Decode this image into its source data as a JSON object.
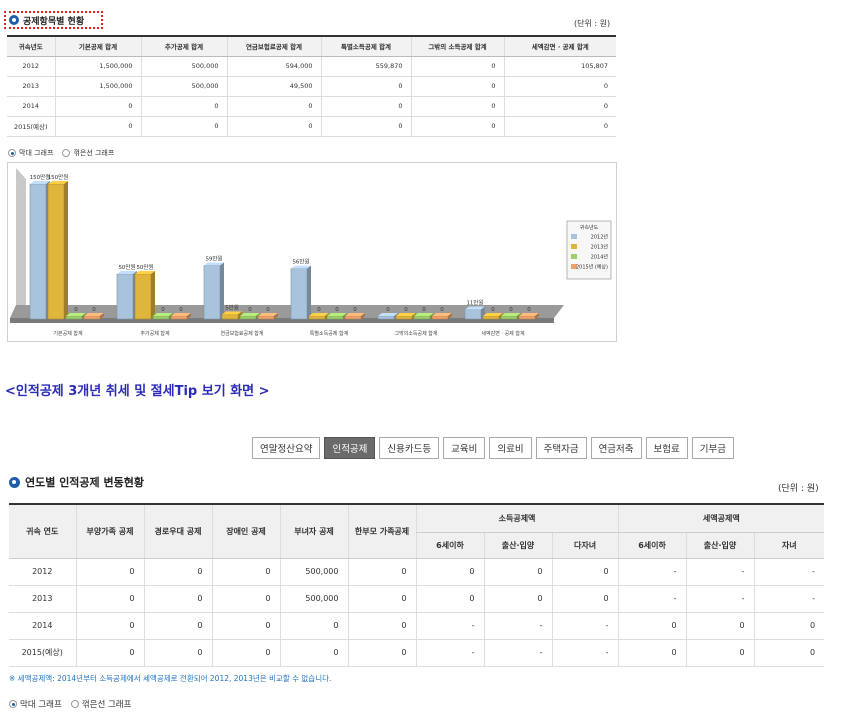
{
  "section1": {
    "title": "공제항목별 현황",
    "unit": "(단위 : 원)",
    "headers": [
      "귀속년도",
      "기본공제 합계",
      "추가공제 합계",
      "연금보험료공제 합계",
      "특별소득공제 합계",
      "그밖의 소득공제 합계",
      "세액감면 · 공제 합계"
    ],
    "rows": [
      [
        "2012",
        "1,500,000",
        "500,000",
        "594,000",
        "559,870",
        "0",
        "105,807"
      ],
      [
        "2013",
        "1,500,000",
        "500,000",
        "49,500",
        "0",
        "0",
        "0"
      ],
      [
        "2014",
        "0",
        "0",
        "0",
        "0",
        "0",
        "0"
      ],
      [
        "2015(예상)",
        "0",
        "0",
        "0",
        "0",
        "0",
        "0"
      ]
    ],
    "radio": {
      "bar": "막대 그래프",
      "line": "꺾은선 그래프",
      "selected": "bar"
    }
  },
  "chart_data": {
    "type": "bar",
    "categories": [
      "기본공제 합계",
      "추가공제 합계",
      "연금보험료공제 합계",
      "특별소득공제 합계",
      "그밖의소득공제 합계",
      "세액감면 · 공제 합계"
    ],
    "series": [
      {
        "name": "2012년",
        "values": [
          1500000,
          500000,
          594000,
          559870,
          0,
          105807
        ],
        "color": "#a9c3dc"
      },
      {
        "name": "2013년",
        "values": [
          1500000,
          500000,
          49500,
          0,
          0,
          0
        ],
        "color": "#e0b53c"
      },
      {
        "name": "2014년",
        "values": [
          0,
          0,
          0,
          0,
          0,
          0
        ],
        "color": "#9fce6a"
      },
      {
        "name": "2015년 (예상)",
        "values": [
          0,
          0,
          0,
          0,
          0,
          0
        ],
        "color": "#eea36a"
      }
    ],
    "data_labels": [
      [
        "150만원",
        "50만원",
        "59만원",
        "56만원",
        "0",
        "11만원"
      ],
      [
        "150만원",
        "50만원",
        "5만원",
        "0",
        "0",
        "0"
      ],
      [
        "0",
        "0",
        "0",
        "0",
        "0",
        "0"
      ],
      [
        "0",
        "0",
        "0",
        "0",
        "0",
        "0"
      ]
    ],
    "legend_title": "귀속년도",
    "legend_position": "right",
    "ylim": [
      0,
      1500000
    ]
  },
  "banner": "<인적공제 3개년 취세 및 절세Tip 보기 화면 >",
  "tabs": [
    "연말정산요약",
    "인적공제",
    "신용카드등",
    "교육비",
    "의료비",
    "주택자금",
    "연금저축",
    "보험료",
    "기부금"
  ],
  "active_tab": 1,
  "section2": {
    "title": "연도별 인적공제 변동현황",
    "unit": "(단위 : 원)",
    "headers": {
      "year": "귀속 연도",
      "dependents": "부양가족 공제",
      "elderly": "경로우대 공제",
      "disabled": "장애인 공제",
      "female": "부녀자 공제",
      "single_parent": "한부모 가족공제",
      "income_group": "소득공제액",
      "tax_group": "세액공제액",
      "sub": [
        "6세이하",
        "출산·입양",
        "다자녀",
        "6세이하",
        "출산·입양",
        "자녀"
      ]
    },
    "rows": [
      [
        "2012",
        "0",
        "0",
        "0",
        "500,000",
        "0",
        "0",
        "0",
        "0",
        "-",
        "-",
        "-"
      ],
      [
        "2013",
        "0",
        "0",
        "0",
        "500,000",
        "0",
        "0",
        "0",
        "0",
        "-",
        "-",
        "-"
      ],
      [
        "2014",
        "0",
        "0",
        "0",
        "0",
        "0",
        "-",
        "-",
        "-",
        "0",
        "0",
        "0"
      ],
      [
        "2015(예상)",
        "0",
        "0",
        "0",
        "0",
        "0",
        "-",
        "-",
        "-",
        "0",
        "0",
        "0"
      ]
    ],
    "note": "※ 세액공제액: 2014년부터 소득공제에서 세액공제로 전환되어 2012, 2013년은 비교할 수 없습니다.",
    "radio": {
      "bar": "막대 그래프",
      "line": "꺾은선 그래프",
      "selected": "bar"
    }
  }
}
